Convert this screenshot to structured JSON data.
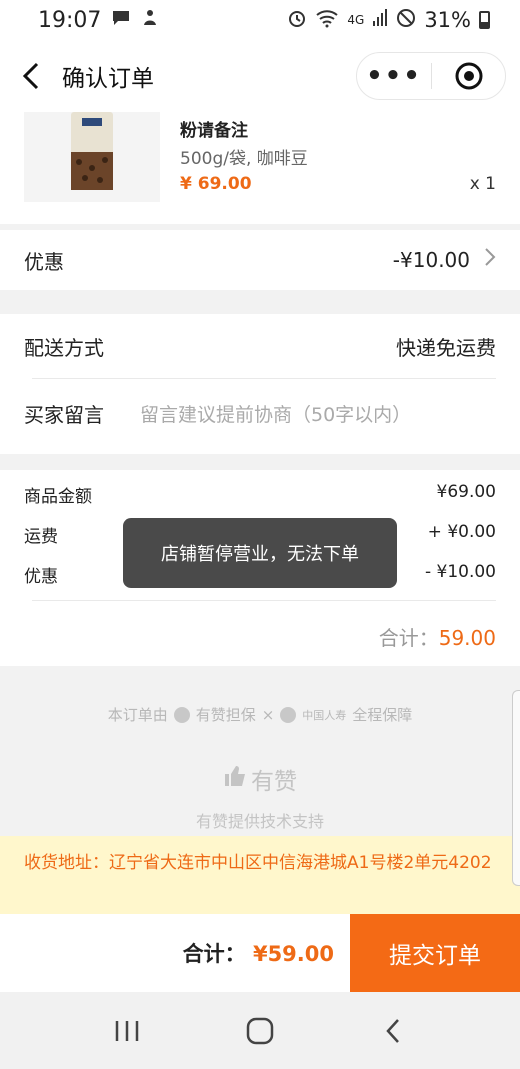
{
  "status_bar": {
    "time": "19:07",
    "network": "4G",
    "battery": "31%"
  },
  "nav": {
    "title": "确认订单",
    "more": "•••"
  },
  "product": {
    "name": "粉请备注",
    "spec": "500g/袋, 咖啡豆",
    "price": "¥ 69.00",
    "qty": "x 1"
  },
  "discount": {
    "label": "优惠",
    "value": "-¥10.00"
  },
  "delivery": {
    "label": "配送方式",
    "value": "快递免运费"
  },
  "message": {
    "label": "买家留言",
    "placeholder": "留言建议提前协商（50字以内）"
  },
  "summary": {
    "rows": [
      {
        "label": "商品金额",
        "value": "¥69.00"
      },
      {
        "label": "运费",
        "value": "+ ¥0.00"
      },
      {
        "label": "优惠",
        "value": "- ¥10.00"
      }
    ],
    "total_label": "合计：",
    "total_value": "59.00"
  },
  "toast": "店铺暂停营业，无法下单",
  "guarantee": {
    "prefix": "本订单由",
    "provider": "有赞担保",
    "times": "×",
    "insurer": "中国人寿",
    "suffix": "全程保障"
  },
  "brand": "有赞",
  "support": "有赞提供技术支持",
  "address": "收货地址：辽宁省大连市中山区中信海港城A1号楼2单元4202",
  "bottom": {
    "total_label": "合计：",
    "total_value": "¥59.00",
    "submit": "提交订单"
  },
  "colors": {
    "accent": "#ee6a16",
    "button": "#f46a15",
    "address_bg": "#fff7cc",
    "toast_bg": "#4a4a4a"
  }
}
